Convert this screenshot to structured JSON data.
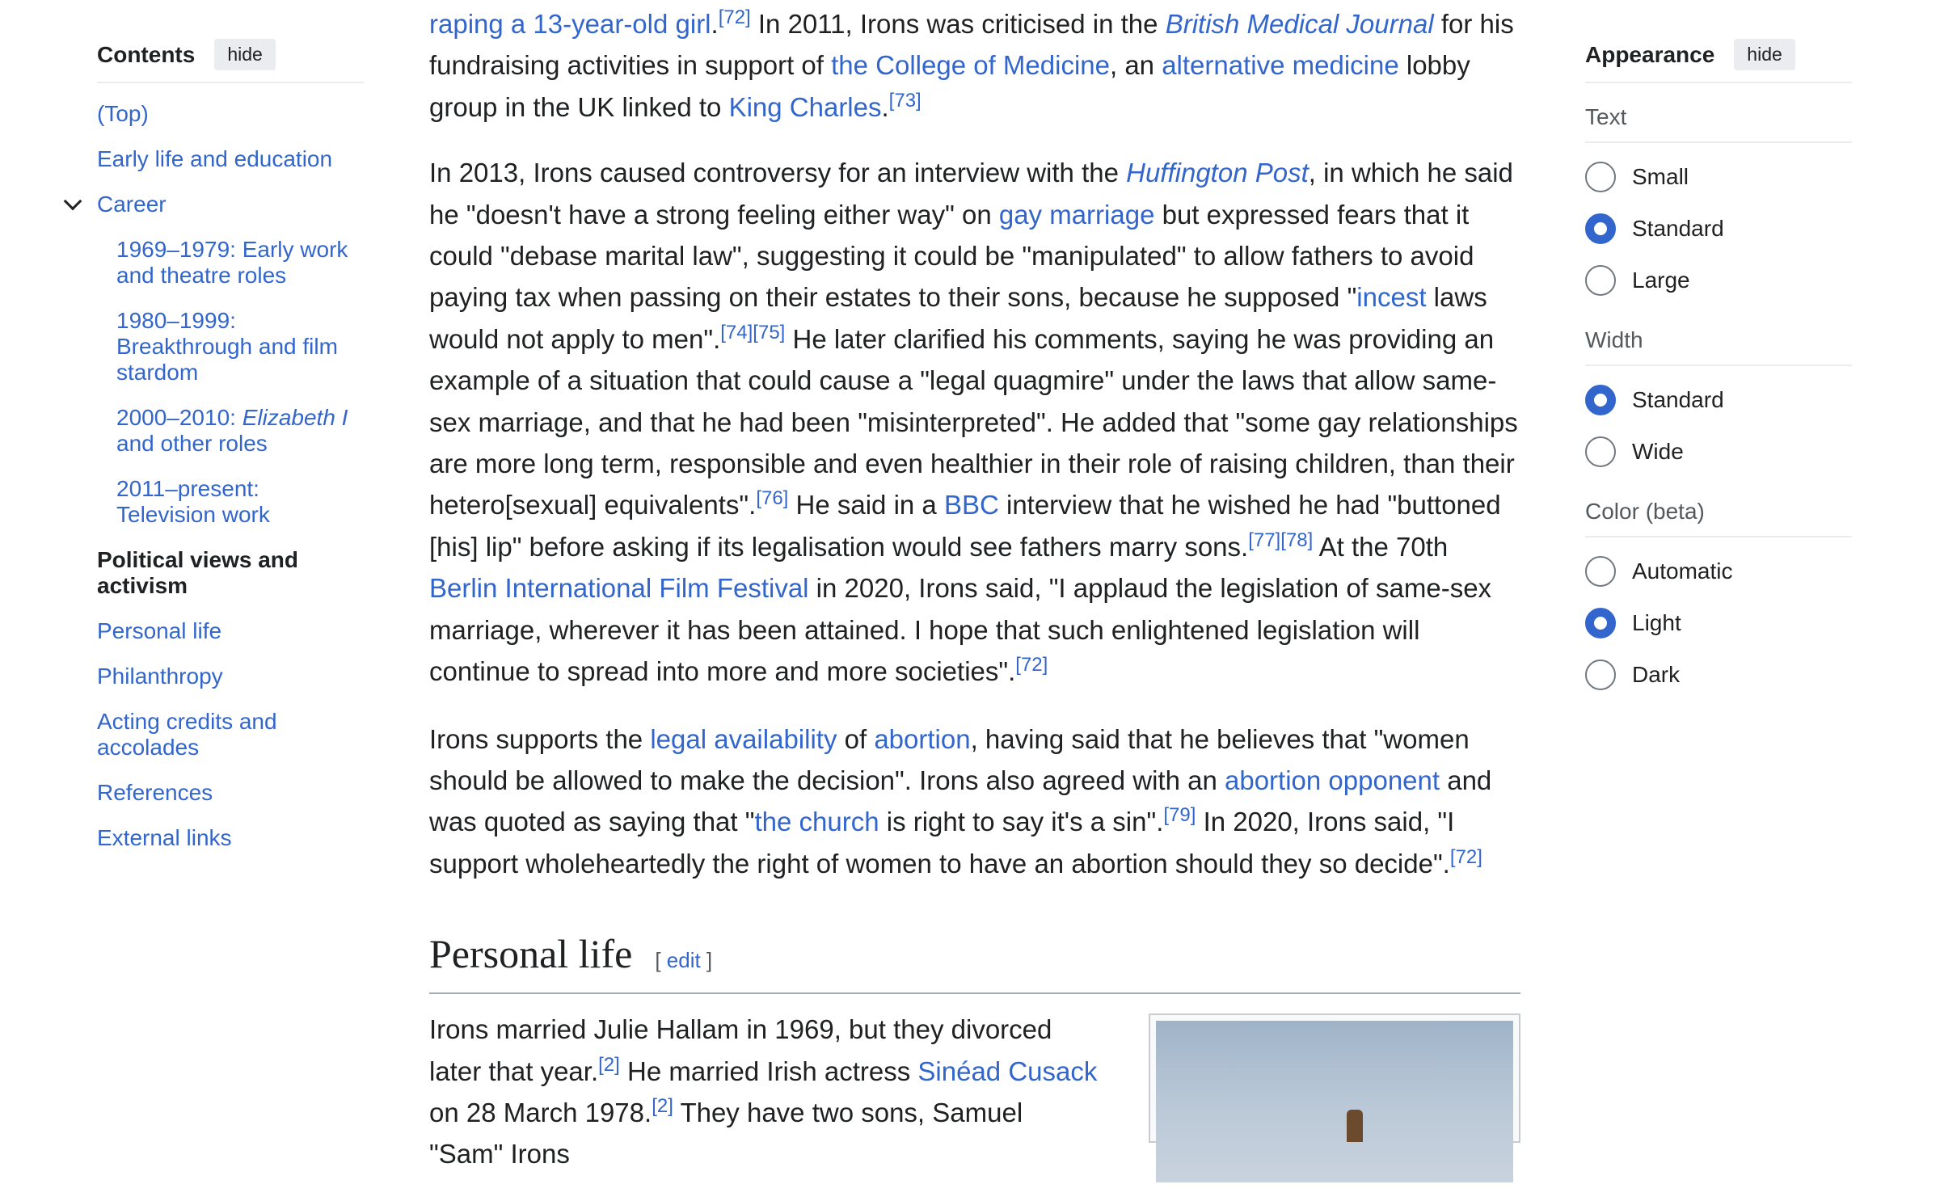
{
  "toc": {
    "title": "Contents",
    "hide_label": "hide",
    "items": [
      {
        "label": "(Top)"
      },
      {
        "label": "Early life and education"
      },
      {
        "label": "Career"
      },
      {
        "label": "1969–1979: Early work and theatre roles"
      },
      {
        "label": "1980–1999: Breakthrough and film stardom"
      },
      {
        "label_prefix": "2000–2010: ",
        "label_italic": "Elizabeth I",
        "label_suffix": " and other roles"
      },
      {
        "label": "2011–present: Television work"
      },
      {
        "label": "Political views and activism"
      },
      {
        "label": "Personal life"
      },
      {
        "label": "Philanthropy"
      },
      {
        "label": "Acting credits and accolades"
      },
      {
        "label": "References"
      },
      {
        "label": "External links"
      }
    ]
  },
  "article": {
    "p1": {
      "l_raping": "raping a 13-year-old girl",
      "t1": ".",
      "r72": "[72]",
      "t2": " In 2011, Irons was criticised in the ",
      "l_bmj": "British Medical Journal",
      "t3": " for his fundraising activities in support of ",
      "l_college": "the College of Medicine",
      "t4": ", an ",
      "l_altmed": "alternative medicine",
      "t5": " lobby group in the UK linked to ",
      "l_king": "King Charles",
      "t6": ".",
      "r73": "[73]"
    },
    "p2": {
      "t1": "In 2013, Irons caused controversy for an interview with the ",
      "l_huff": "Huffington Post",
      "t2": ", in which he said he \"doesn't have a strong feeling either way\" on ",
      "l_gay": "gay marriage",
      "t3": " but expressed fears that it could \"debase marital law\", suggesting it could be \"manipulated\" to allow fathers to avoid paying tax when passing on their estates to their sons, because he supposed \"",
      "l_incest": "incest",
      "t4": " laws would not apply to men\".",
      "r74": "[74]",
      "r75": "[75]",
      "t5": " He later clarified his comments, saying he was providing an example of a situation that could cause a \"legal quagmire\" under the laws that allow same-sex marriage, and that he had been \"misinterpreted\". He added that \"some gay relationships are more long term, responsible and even healthier in their role of raising children, than their hetero[sexual] equivalents\".",
      "r76": "[76]",
      "t6": " He said in a ",
      "l_bbc": "BBC",
      "t7": " interview that he wished he had \"buttoned [his] lip\" before asking if its legalisation would see fathers marry sons.",
      "r77": "[77]",
      "r78": "[78]",
      "t8": " At the 70th ",
      "l_berlin": "Berlin International Film Festival",
      "t9": " in 2020, Irons said, \"I applaud the legislation of same-sex marriage, wherever it has been attained. I hope that such enlightened legislation will continue to spread into more and more societies\".",
      "r72": "[72]"
    },
    "p3": {
      "t1": "Irons supports the ",
      "l_legal": "legal availability",
      "t2": " of ",
      "l_abortion": "abortion",
      "t3": ", having said that he believes that \"women should be allowed to make the decision\". Irons also agreed with an ",
      "l_opponent": "abortion opponent",
      "t4": " and was quoted as saying that \"",
      "l_church": "the church",
      "t5": " is right to say it's a sin\".",
      "r79": "[79]",
      "t6": " In 2020, Irons said, \"I support wholeheartedly the right of women to have an abortion should they so decide\".",
      "r72": "[72]"
    },
    "personal": {
      "heading": "Personal life",
      "edit_open": "[ ",
      "edit_label": "edit",
      "edit_close": " ]",
      "t1": "Irons married Julie Hallam in 1969, but they divorced later that year.",
      "r2a": "[2]",
      "t2": " He married Irish actress ",
      "l_sinead": "Sinéad Cusack",
      "t3": " on 28 March 1978.",
      "r2b": "[2]",
      "t4": " They have two sons, Samuel \"Sam\" Irons"
    }
  },
  "appearance": {
    "title": "Appearance",
    "hide_label": "hide",
    "groups": [
      {
        "label": "Text",
        "options": [
          "Small",
          "Standard",
          "Large"
        ],
        "selected": "Standard"
      },
      {
        "label": "Width",
        "options": [
          "Standard",
          "Wide"
        ],
        "selected": "Standard"
      },
      {
        "label": "Color (beta)",
        "options": [
          "Automatic",
          "Light",
          "Dark"
        ],
        "selected": "Light"
      }
    ]
  },
  "colors": {
    "link": "#3366cc",
    "text": "#202122",
    "accent": "#3366cc",
    "muted": "#54595d"
  }
}
